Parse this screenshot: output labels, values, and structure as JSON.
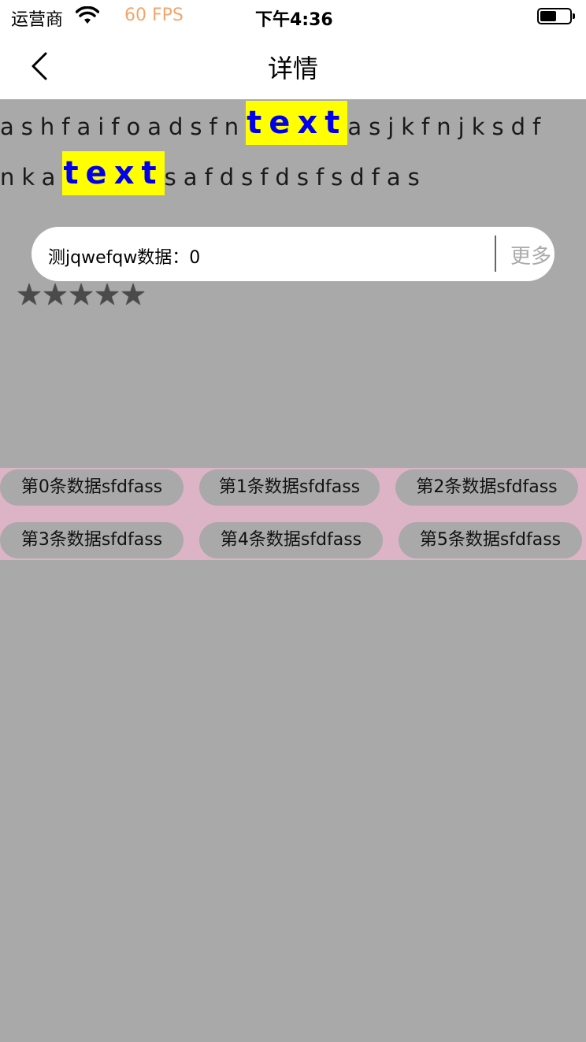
{
  "status_bar": {
    "carrier": "运营商",
    "fps": "60 FPS",
    "time": "下午4:36"
  },
  "nav": {
    "title": "详情"
  },
  "rich_text": {
    "line1_before": "ashfaifoadsfn",
    "line1_highlight": "text",
    "line1_after": "asjkfnjksdf",
    "line2_before": "nka",
    "line2_highlight": "text",
    "line2_after": "safdsfdsfsdfas"
  },
  "data_pill": {
    "label": "测jqwefqw数据：0",
    "more": "更多"
  },
  "rating": {
    "stars": 5,
    "glyph": "★"
  },
  "tags": [
    "第0条数据sfdfass",
    "第1条数据sfdfass",
    "第2条数据sfdfass",
    "第3条数据sfdfass",
    "第4条数据sfdfass",
    "第5条数据sfdfass"
  ],
  "colors": {
    "background": "#a9a9a9",
    "highlight_bg": "#ffff00",
    "highlight_text": "#0000ee",
    "tags_bg": "#dcb4c6",
    "fps": "#f2a66b"
  }
}
